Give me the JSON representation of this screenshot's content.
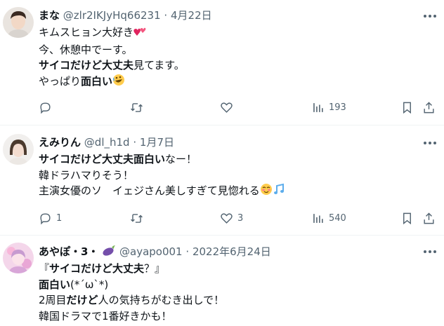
{
  "tweets": [
    {
      "name": "まな",
      "handle": "@zlr2IKJyHq66231",
      "dot": "·",
      "date": "4月22日",
      "lines": [
        [
          {
            "t": "キムスヒョン大好き",
            "b": false
          },
          {
            "e": "heart"
          }
        ],
        [
          {
            "t": "今、休憩中でーす。",
            "b": false
          }
        ],
        [
          {
            "t": "サイコだけど大丈夫",
            "b": true
          },
          {
            "t": "見てます。",
            "b": false
          }
        ],
        [
          {
            "t": "やっぱり",
            "b": false
          },
          {
            "t": "面白い",
            "b": true
          },
          {
            "e": "rofl"
          }
        ]
      ],
      "actions": {
        "reply": "",
        "retweet": "",
        "like": "",
        "views": "193"
      }
    },
    {
      "name": "えみりん",
      "handle": "@dl_h1d",
      "dot": "·",
      "date": "1月7日",
      "lines": [
        [
          {
            "t": "サイコだけど大丈夫面白い",
            "b": true
          },
          {
            "t": "なー！",
            "b": false
          }
        ],
        [
          {
            "t": "韓ドラハマりそう！",
            "b": false
          }
        ],
        [
          {
            "t": "主演女優のソ　イェジさん美しすぎて見惚れる",
            "b": false
          },
          {
            "e": "blush"
          },
          {
            "e": "notes"
          }
        ]
      ],
      "actions": {
        "reply": "1",
        "retweet": "",
        "like": "3",
        "views": "540"
      }
    },
    {
      "name": "あやぽ・3・",
      "handle": "@ayapo001",
      "dot": "·",
      "date": "2022年6月24日",
      "lines": [
        [
          {
            "t": "『",
            "b": false
          },
          {
            "t": "サイコだけど大丈夫",
            "b": true
          },
          {
            "t": "？』",
            "b": false
          }
        ],
        [
          {
            "t": "面白い",
            "b": true
          },
          {
            "t": "(*´ω`*)",
            "b": false
          }
        ],
        [
          {
            "t": "2周目",
            "b": false
          },
          {
            "t": "だけど",
            "b": true
          },
          {
            "t": "人の気持ちがむき出しで！",
            "b": false
          }
        ],
        [
          {
            "t": "韓国ドラマで1番好きかも！",
            "b": false
          }
        ]
      ],
      "actions": {
        "reply": "",
        "retweet": "",
        "like": "",
        "views": ""
      }
    }
  ],
  "icons": {
    "more": "more-horizontal-icon",
    "reply": "reply-icon",
    "retweet": "retweet-icon",
    "like": "like-icon",
    "views": "views-icon",
    "bookmark": "bookmark-icon",
    "share": "share-icon",
    "eggplant": "eggplant-emoji"
  },
  "colors": {
    "text": "#0f1419",
    "secondary": "#536471",
    "divider": "#eff3f4"
  }
}
